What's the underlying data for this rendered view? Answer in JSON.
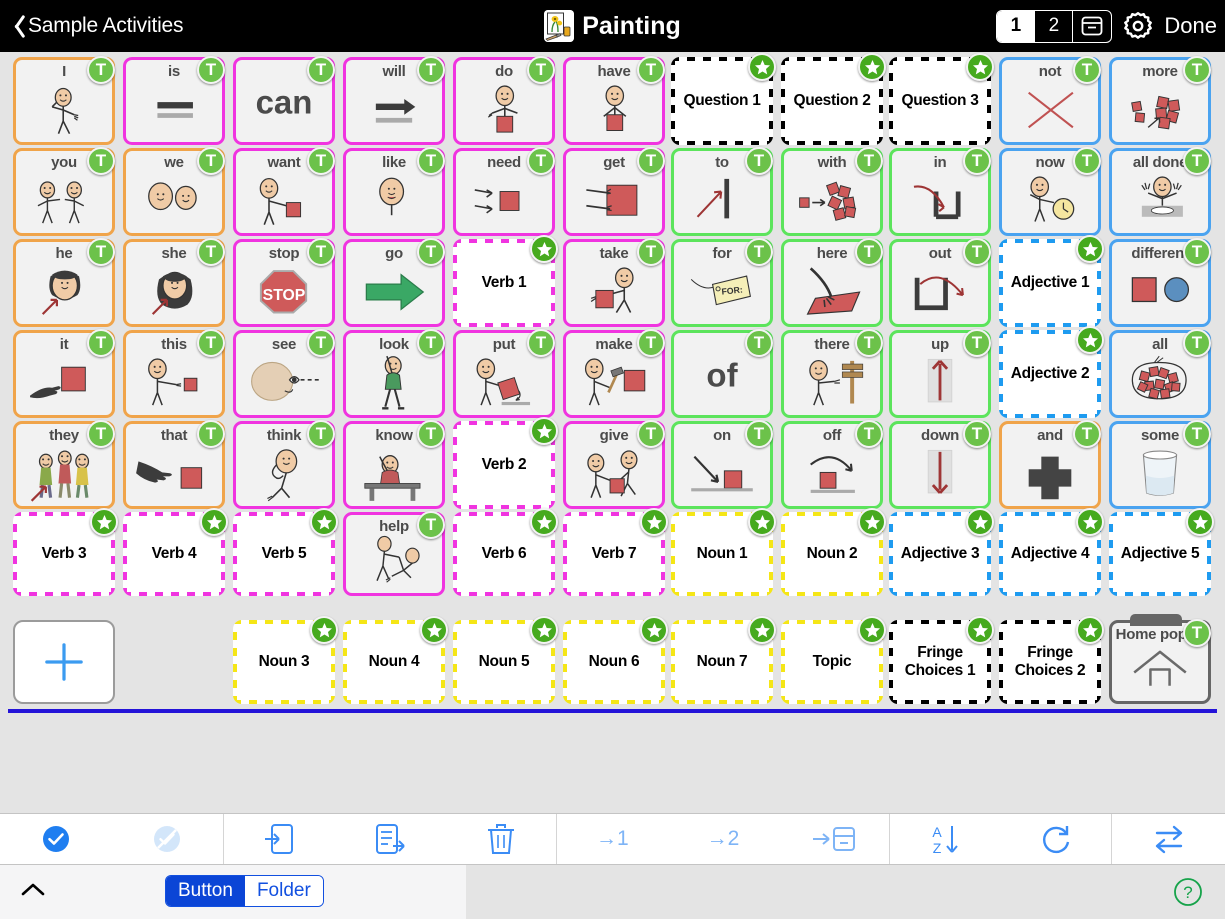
{
  "header": {
    "back_label": "Sample Activities",
    "title": "Painting",
    "title_icon": "painting-icon",
    "pages": [
      {
        "label": "1",
        "active": true
      },
      {
        "label": "2",
        "active": false
      },
      {
        "label": "",
        "icon": "archive-box-icon",
        "active": false
      }
    ],
    "gear_icon": "gear-icon",
    "done_label": "Done"
  },
  "grid": {
    "columns": 11,
    "rows": 7,
    "add_button": {
      "name": "add-button",
      "icon": "plus-icon"
    },
    "cells": [
      {
        "label": "I",
        "color": "#f0a44a",
        "style": "solid",
        "badge": "T",
        "art": "person-point-self"
      },
      {
        "label": "is",
        "color": "#f034e0",
        "style": "solid",
        "badge": "T",
        "art": "equals"
      },
      {
        "label": "",
        "color": "#f034e0",
        "style": "solid",
        "badge": "T",
        "word": "can"
      },
      {
        "label": "will",
        "color": "#f034e0",
        "style": "solid",
        "badge": "T",
        "art": "arrow-right-gray"
      },
      {
        "label": "do",
        "color": "#f034e0",
        "style": "solid",
        "badge": "T",
        "art": "person-do"
      },
      {
        "label": "have",
        "color": "#f034e0",
        "style": "solid",
        "badge": "T",
        "art": "person-have"
      },
      {
        "label": "Question 1",
        "color": "#000000",
        "style": "dashed",
        "badge": "star",
        "placeholder": true
      },
      {
        "label": "Question 2",
        "color": "#000000",
        "style": "dashed",
        "badge": "star",
        "placeholder": true
      },
      {
        "label": "Question 3",
        "color": "#000000",
        "style": "dashed",
        "badge": "star",
        "placeholder": true
      },
      {
        "label": "not",
        "color": "#4aa3f0",
        "style": "solid",
        "badge": "T",
        "art": "cross-x"
      },
      {
        "label": "more",
        "color": "#4aa3f0",
        "style": "solid",
        "badge": "T",
        "art": "more-blocks"
      },
      {
        "label": "you",
        "color": "#f0a44a",
        "style": "solid",
        "badge": "T",
        "art": "two-people-point"
      },
      {
        "label": "we",
        "color": "#f0a44a",
        "style": "solid",
        "badge": "T",
        "art": "two-heads"
      },
      {
        "label": "want",
        "color": "#f034e0",
        "style": "solid",
        "badge": "T",
        "art": "person-want"
      },
      {
        "label": "like",
        "color": "#f034e0",
        "style": "solid",
        "badge": "T",
        "art": "person-like"
      },
      {
        "label": "need",
        "color": "#f034e0",
        "style": "solid",
        "badge": "T",
        "art": "hands-need"
      },
      {
        "label": "get",
        "color": "#f034e0",
        "style": "solid",
        "badge": "T",
        "art": "hands-get"
      },
      {
        "label": "to",
        "color": "#5ce45c",
        "style": "solid",
        "badge": "T",
        "art": "arrow-to-bar"
      },
      {
        "label": "with",
        "color": "#5ce45c",
        "style": "solid",
        "badge": "T",
        "art": "blocks-with"
      },
      {
        "label": "in",
        "color": "#5ce45c",
        "style": "solid",
        "badge": "T",
        "art": "arrow-in"
      },
      {
        "label": "now",
        "color": "#4aa3f0",
        "style": "solid",
        "badge": "T",
        "art": "person-clock"
      },
      {
        "label": "all done",
        "color": "#4aa3f0",
        "style": "solid",
        "badge": "T",
        "art": "person-alldone"
      },
      {
        "label": "he",
        "color": "#f0a44a",
        "style": "solid",
        "badge": "T",
        "art": "head-male"
      },
      {
        "label": "she",
        "color": "#f0a44a",
        "style": "solid",
        "badge": "T",
        "art": "head-female"
      },
      {
        "label": "stop",
        "color": "#f034e0",
        "style": "solid",
        "badge": "T",
        "art": "stop-sign"
      },
      {
        "label": "go",
        "color": "#f034e0",
        "style": "solid",
        "badge": "T",
        "art": "green-arrow"
      },
      {
        "label": "Verb 1",
        "color": "#f034e0",
        "style": "dashed",
        "badge": "star",
        "placeholder": true
      },
      {
        "label": "take",
        "color": "#f034e0",
        "style": "solid",
        "badge": "T",
        "art": "person-take"
      },
      {
        "label": "for",
        "color": "#5ce45c",
        "style": "solid",
        "badge": "T",
        "art": "for-tag"
      },
      {
        "label": "here",
        "color": "#5ce45c",
        "style": "solid",
        "badge": "T",
        "art": "here-hand"
      },
      {
        "label": "out",
        "color": "#5ce45c",
        "style": "solid",
        "badge": "T",
        "art": "arrow-out"
      },
      {
        "label": "Adjective 1",
        "color": "#1e9bf0",
        "style": "dashed",
        "badge": "star",
        "placeholder": true
      },
      {
        "label": "different",
        "color": "#4aa3f0",
        "style": "solid",
        "badge": "T",
        "art": "square-circle"
      },
      {
        "label": "it",
        "color": "#f0a44a",
        "style": "solid",
        "badge": "T",
        "art": "point-square"
      },
      {
        "label": "this",
        "color": "#f0a44a",
        "style": "solid",
        "badge": "T",
        "art": "person-this"
      },
      {
        "label": "see",
        "color": "#f034e0",
        "style": "solid",
        "badge": "T",
        "art": "eye-see"
      },
      {
        "label": "look",
        "color": "#f034e0",
        "style": "solid",
        "badge": "T",
        "art": "person-look"
      },
      {
        "label": "put",
        "color": "#f034e0",
        "style": "solid",
        "badge": "T",
        "art": "person-put"
      },
      {
        "label": "make",
        "color": "#f034e0",
        "style": "solid",
        "badge": "T",
        "art": "person-make"
      },
      {
        "label": "",
        "color": "#5ce45c",
        "style": "solid",
        "badge": "T",
        "word": "of"
      },
      {
        "label": "there",
        "color": "#5ce45c",
        "style": "solid",
        "badge": "T",
        "art": "person-there"
      },
      {
        "label": "up",
        "color": "#5ce45c",
        "style": "solid",
        "badge": "T",
        "art": "arrow-up"
      },
      {
        "label": "Adjective 2",
        "color": "#1e9bf0",
        "style": "dashed",
        "badge": "star",
        "placeholder": true
      },
      {
        "label": "all",
        "color": "#4aa3f0",
        "style": "solid",
        "badge": "T",
        "art": "all-blocks"
      },
      {
        "label": "they",
        "color": "#f0a44a",
        "style": "solid",
        "badge": "T",
        "art": "three-people"
      },
      {
        "label": "that",
        "color": "#f0a44a",
        "style": "solid",
        "badge": "T",
        "art": "hand-that"
      },
      {
        "label": "think",
        "color": "#f034e0",
        "style": "solid",
        "badge": "T",
        "art": "person-think"
      },
      {
        "label": "know",
        "color": "#f034e0",
        "style": "solid",
        "badge": "T",
        "art": "person-know"
      },
      {
        "label": "Verb 2",
        "color": "#f034e0",
        "style": "dashed",
        "badge": "star",
        "placeholder": true
      },
      {
        "label": "give",
        "color": "#f034e0",
        "style": "solid",
        "badge": "T",
        "art": "person-give"
      },
      {
        "label": "on",
        "color": "#5ce45c",
        "style": "solid",
        "badge": "T",
        "art": "arrow-on"
      },
      {
        "label": "off",
        "color": "#5ce45c",
        "style": "solid",
        "badge": "T",
        "art": "arrow-off"
      },
      {
        "label": "down",
        "color": "#5ce45c",
        "style": "solid",
        "badge": "T",
        "art": "arrow-down"
      },
      {
        "label": "and",
        "color": "#f0a44a",
        "style": "solid",
        "badge": "T",
        "art": "plus-sign"
      },
      {
        "label": "some",
        "color": "#4aa3f0",
        "style": "solid",
        "badge": "T",
        "art": "glass-some"
      },
      {
        "label": "Verb 3",
        "color": "#f034e0",
        "style": "dashed",
        "badge": "star",
        "placeholder": true
      },
      {
        "label": "Verb 4",
        "color": "#f034e0",
        "style": "dashed",
        "badge": "star",
        "placeholder": true
      },
      {
        "label": "Verb 5",
        "color": "#f034e0",
        "style": "dashed",
        "badge": "star",
        "placeholder": true
      },
      {
        "label": "help",
        "color": "#f034e0",
        "style": "solid",
        "badge": "T",
        "art": "person-help"
      },
      {
        "label": "Verb 6",
        "color": "#f034e0",
        "style": "dashed",
        "badge": "star",
        "placeholder": true
      },
      {
        "label": "Verb 7",
        "color": "#f034e0",
        "style": "dashed",
        "badge": "star",
        "placeholder": true
      },
      {
        "label": "Noun 1",
        "color": "#f5e616",
        "style": "dashed",
        "badge": "star",
        "placeholder": true
      },
      {
        "label": "Noun 2",
        "color": "#f5e616",
        "style": "dashed",
        "badge": "star",
        "placeholder": true
      },
      {
        "label": "Adjective 3",
        "color": "#1e9bf0",
        "style": "dashed",
        "badge": "star",
        "placeholder": true
      },
      {
        "label": "Adjective 4",
        "color": "#1e9bf0",
        "style": "dashed",
        "badge": "star",
        "placeholder": true
      },
      {
        "label": "Adjective 5",
        "color": "#1e9bf0",
        "style": "dashed",
        "badge": "star",
        "placeholder": true
      },
      {
        "add": true
      },
      {
        "empty": true
      },
      {
        "label": "Noun 3",
        "color": "#f5e616",
        "style": "dashed",
        "badge": "star",
        "placeholder": true
      },
      {
        "label": "Noun 4",
        "color": "#f5e616",
        "style": "dashed",
        "badge": "star",
        "placeholder": true
      },
      {
        "label": "Noun 5",
        "color": "#f5e616",
        "style": "dashed",
        "badge": "star",
        "placeholder": true
      },
      {
        "label": "Noun 6",
        "color": "#f5e616",
        "style": "dashed",
        "badge": "star",
        "placeholder": true
      },
      {
        "label": "Noun 7",
        "color": "#f5e616",
        "style": "dashed",
        "badge": "star",
        "placeholder": true
      },
      {
        "label": "Topic",
        "color": "#f5e616",
        "style": "dashed",
        "badge": "star",
        "placeholder": true
      },
      {
        "label": "Fringe\nChoices 1",
        "color": "#000000",
        "style": "dashed",
        "badge": "star",
        "placeholder": true
      },
      {
        "label": "Fringe\nChoices 2",
        "color": "#000000",
        "style": "dashed",
        "badge": "star",
        "placeholder": true
      },
      {
        "label": "Home popup",
        "color": "#666666",
        "style": "folder",
        "badge": "T",
        "art": "home-icon"
      }
    ]
  },
  "toolbar": {
    "buttons": [
      {
        "name": "select-all-button",
        "icon": "check-circle-icon",
        "label": ""
      },
      {
        "name": "deselect-button",
        "icon": "no-select-icon",
        "label": ""
      },
      {
        "name": "import-button",
        "icon": "import-icon",
        "label": ""
      },
      {
        "name": "export-button",
        "icon": "export-icon",
        "label": ""
      },
      {
        "name": "delete-button",
        "icon": "trash-icon",
        "label": ""
      },
      {
        "name": "move-to-page-1-button",
        "icon": "arrow-to-1-icon",
        "label": "→1"
      },
      {
        "name": "move-to-page-2-button",
        "icon": "arrow-to-2-icon",
        "label": "→2"
      },
      {
        "name": "move-to-archive-button",
        "icon": "arrow-to-box-icon",
        "label": ""
      },
      {
        "name": "sort-az-button",
        "icon": "sort-az-icon",
        "label": ""
      },
      {
        "name": "refresh-button",
        "icon": "refresh-icon",
        "label": ""
      },
      {
        "name": "swap-button",
        "icon": "swap-icon",
        "label": ""
      }
    ]
  },
  "footer": {
    "collapse_icon": "chevron-up-icon",
    "toggle": {
      "options": [
        {
          "label": "Button",
          "active": true
        },
        {
          "label": "Folder",
          "active": false
        }
      ]
    },
    "help_icon": "help-circle-icon"
  },
  "colors": {
    "pronoun_orange": "#f0a44a",
    "verb_magenta": "#f034e0",
    "preposition_green": "#5ce45c",
    "adjective_blue": "#4aa3f0",
    "noun_yellow": "#f5e616",
    "question_black": "#000000",
    "accent_blue": "#3b8cf5",
    "rule_blue": "#2413d8"
  }
}
